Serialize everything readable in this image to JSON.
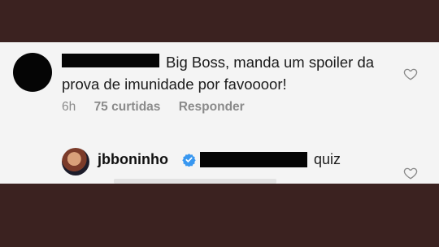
{
  "comment": {
    "text": "Big Boss, manda um spoiler da prova de imunidade por favoooor!",
    "time": "6h",
    "likes": "75 curtidas",
    "reply_label": "Responder"
  },
  "reply": {
    "username": "jbboninho",
    "text": "quiz"
  },
  "icons": {
    "like": "heart-outline-icon",
    "verified": "verified-badge-icon"
  },
  "colors": {
    "background": "#3b2220",
    "panel": "#f4f4f4",
    "verified": "#3897f0",
    "meta_text": "#8a8a8a"
  }
}
